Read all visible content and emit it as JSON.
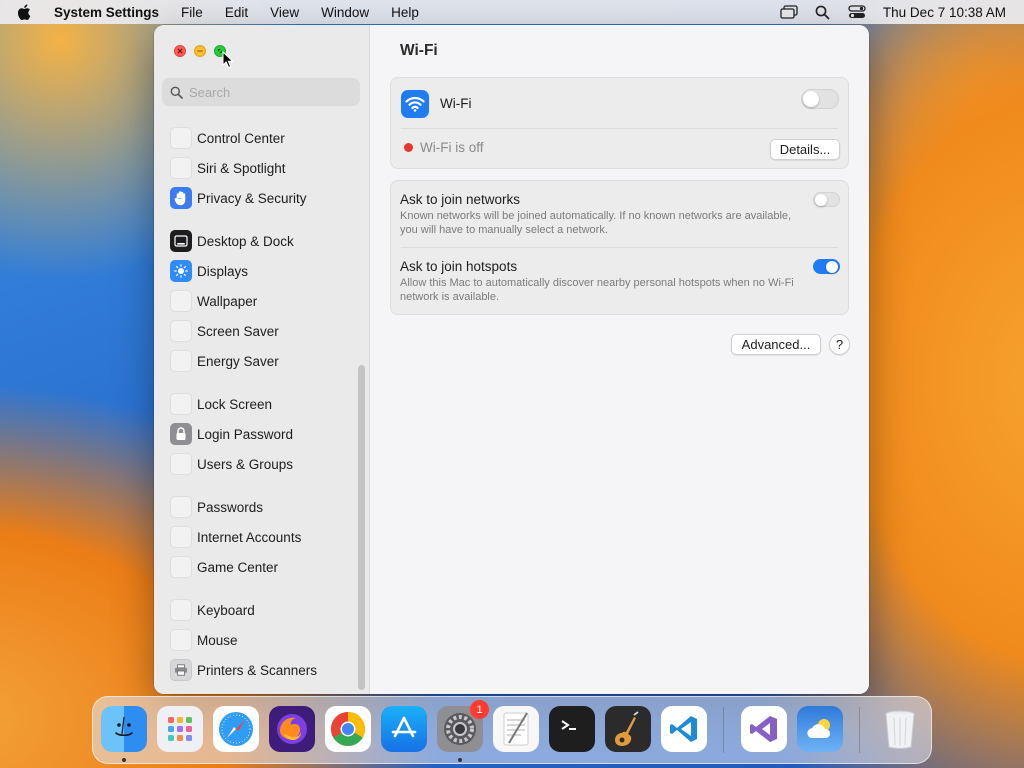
{
  "menubar": {
    "app_name": "System Settings",
    "menus": [
      "File",
      "Edit",
      "View",
      "Window",
      "Help"
    ],
    "clock": "Thu Dec 7  10:38 AM"
  },
  "sidebar": {
    "search_placeholder": "Search",
    "items": [
      {
        "label": "Control Center",
        "icon": "control-center-icon"
      },
      {
        "label": "Siri & Spotlight",
        "icon": "siri-icon"
      },
      {
        "label": "Privacy & Security",
        "icon": "hand-icon"
      },
      {
        "label": "Desktop & Dock",
        "icon": "desktop-dock-icon"
      },
      {
        "label": "Displays",
        "icon": "sun-icon"
      },
      {
        "label": "Wallpaper",
        "icon": "wallpaper-icon"
      },
      {
        "label": "Screen Saver",
        "icon": "screen-saver-icon"
      },
      {
        "label": "Energy Saver",
        "icon": "battery-icon"
      },
      {
        "label": "Lock Screen",
        "icon": "lock-screen-icon"
      },
      {
        "label": "Login Password",
        "icon": "padlock-icon"
      },
      {
        "label": "Users & Groups",
        "icon": "users-icon"
      },
      {
        "label": "Passwords",
        "icon": "key-icon"
      },
      {
        "label": "Internet Accounts",
        "icon": "at-icon"
      },
      {
        "label": "Game Center",
        "icon": "game-center-icon"
      },
      {
        "label": "Keyboard",
        "icon": "keyboard-icon"
      },
      {
        "label": "Mouse",
        "icon": "mouse-icon"
      },
      {
        "label": "Printers & Scanners",
        "icon": "printer-icon"
      }
    ]
  },
  "main": {
    "title": "Wi-Fi",
    "wifi": {
      "label": "Wi-Fi",
      "enabled": false,
      "status": "Wi-Fi is off",
      "status_color": "#e7372c",
      "details_button": "Details..."
    },
    "settings": [
      {
        "title": "Ask to join networks",
        "description": "Known networks will be joined automatically. If no known networks are available, you will have to manually select a network.",
        "enabled": false
      },
      {
        "title": "Ask to join hotspots",
        "description": "Allow this Mac to automatically discover nearby personal hotspots when no Wi-Fi network is available.",
        "enabled": true
      }
    ],
    "advanced_button": "Advanced...",
    "help_button": "?"
  },
  "dock": {
    "apps": [
      {
        "name": "Finder",
        "icon": "finder-icon",
        "running": true
      },
      {
        "name": "Launchpad",
        "icon": "launchpad-icon",
        "running": false
      },
      {
        "name": "Safari",
        "icon": "safari-icon",
        "running": false
      },
      {
        "name": "Firefox",
        "icon": "firefox-icon",
        "running": false
      },
      {
        "name": "Chrome",
        "icon": "chrome-icon",
        "running": false
      },
      {
        "name": "App Store",
        "icon": "app-store-icon",
        "running": false
      },
      {
        "name": "System Settings",
        "icon": "system-settings-icon",
        "running": true,
        "badge": "1"
      },
      {
        "name": "TextEdit",
        "icon": "textedit-icon",
        "running": false
      },
      {
        "name": "Terminal",
        "icon": "terminal-icon",
        "running": false
      },
      {
        "name": "GarageBand",
        "icon": "garageband-icon",
        "running": false
      },
      {
        "name": "Visual Studio Code",
        "icon": "vscode-icon",
        "running": false
      },
      {
        "name": "Visual Studio",
        "icon": "visual-studio-icon",
        "running": false
      },
      {
        "name": "Weather",
        "icon": "weather-icon",
        "running": false
      },
      {
        "name": "Trash",
        "icon": "trash-icon",
        "running": false
      }
    ]
  },
  "colors": {
    "accent": "#1f7cf5",
    "close": "#ff5f57",
    "minimize": "#febc2e",
    "zoom": "#28c840"
  }
}
